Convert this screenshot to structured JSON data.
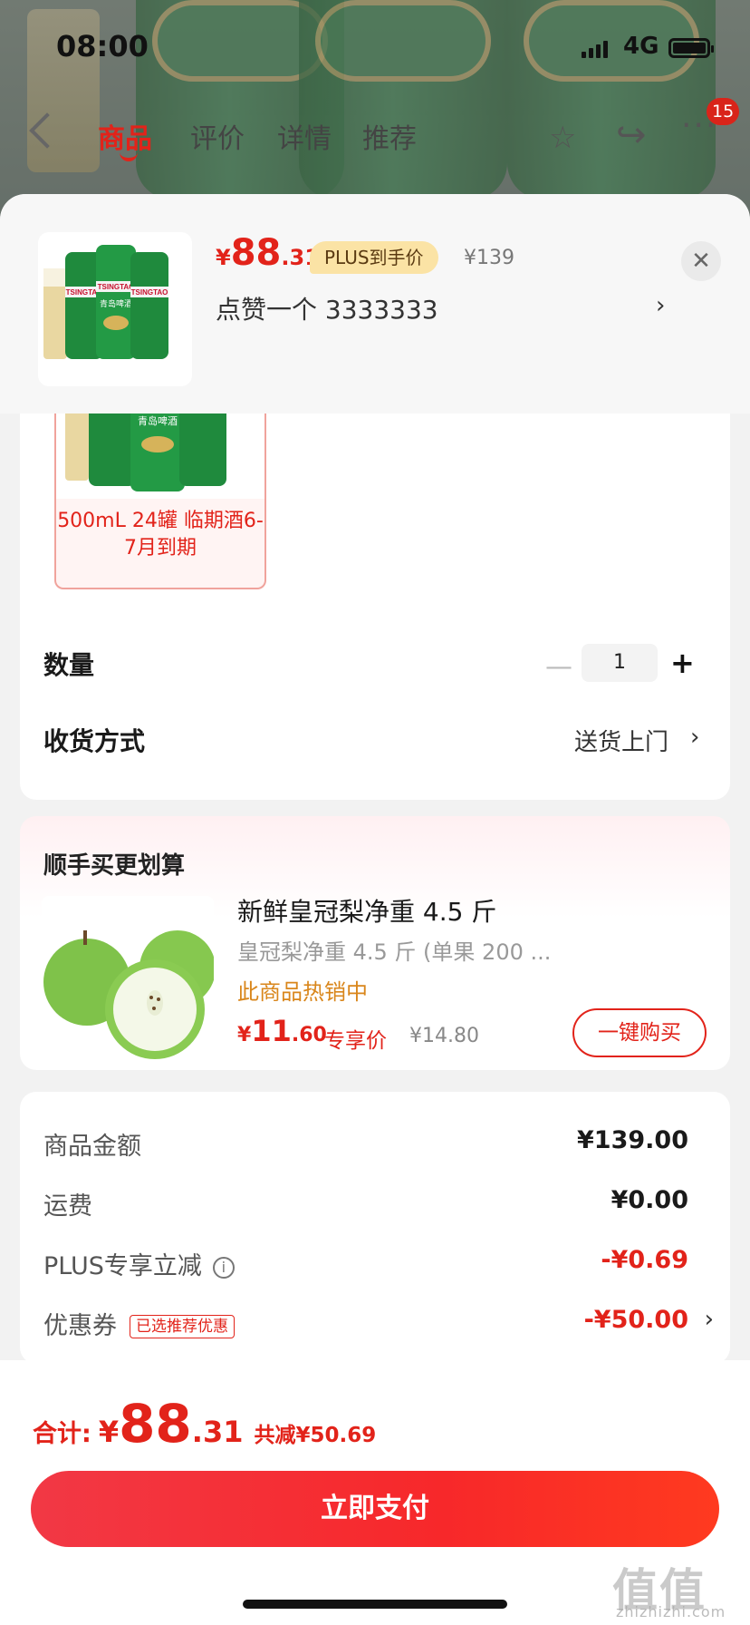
{
  "status_bar": {
    "time": "08:00",
    "network": "4G",
    "battery_level": 1.0
  },
  "nav": {
    "tabs": [
      {
        "label": "商品",
        "active": true
      },
      {
        "label": "评价",
        "active": false
      },
      {
        "label": "详情",
        "active": false
      },
      {
        "label": "推荐",
        "active": false
      }
    ],
    "cart_badge": "15",
    "icons": [
      "back-icon",
      "star-icon",
      "share-icon",
      "more-icon"
    ]
  },
  "product_header": {
    "price_currency": "¥",
    "price_integer": "88",
    "price_decimal": ".31",
    "plus_tag": "PLUS到手价",
    "original_price": "¥139",
    "spec_line": "点赞一个  3333333",
    "can_brand": "TSINGTAO",
    "can_name": "青岛啤酒"
  },
  "sku": {
    "label": "500mL 24罐 临期酒6-7月到期",
    "quantity_label": "数量",
    "quantity_value": "1",
    "delivery_label": "收货方式",
    "delivery_value": "送货上门"
  },
  "upsell": {
    "title": "顺手买更划算",
    "product_name": "新鲜皇冠梨净重 4.5 斤",
    "product_desc": "皇冠梨净重 4.5 斤 (单果 200 ...",
    "hot_text": "此商品热销中",
    "price_currency": "¥",
    "price_integer": "11",
    "price_decimal": ".60",
    "price_tag": "专享价",
    "original_price": "¥14.80",
    "buy_button": "一键购买"
  },
  "summary": {
    "goods_label": "商品金额",
    "goods_value": "¥139.00",
    "shipping_label": "运费",
    "shipping_value": "¥0.00",
    "plus_label": "PLUS专享立减",
    "plus_value": "-¥0.69",
    "coupon_label": "优惠券",
    "coupon_tag": "已选推荐优惠",
    "coupon_value": "-¥50.00"
  },
  "footer": {
    "total_label": "合计:",
    "total_currency": "¥",
    "total_integer": "88",
    "total_decimal": ".31",
    "saved_text": "共减¥50.69",
    "pay_button": "立即支付",
    "watermark": "值值值",
    "watermark_sub": "zhizhizhi.com"
  },
  "colors": {
    "accent": "#e2231a",
    "plus_tag_bg": "#fbe3a5",
    "hot_text": "#d9861b"
  }
}
